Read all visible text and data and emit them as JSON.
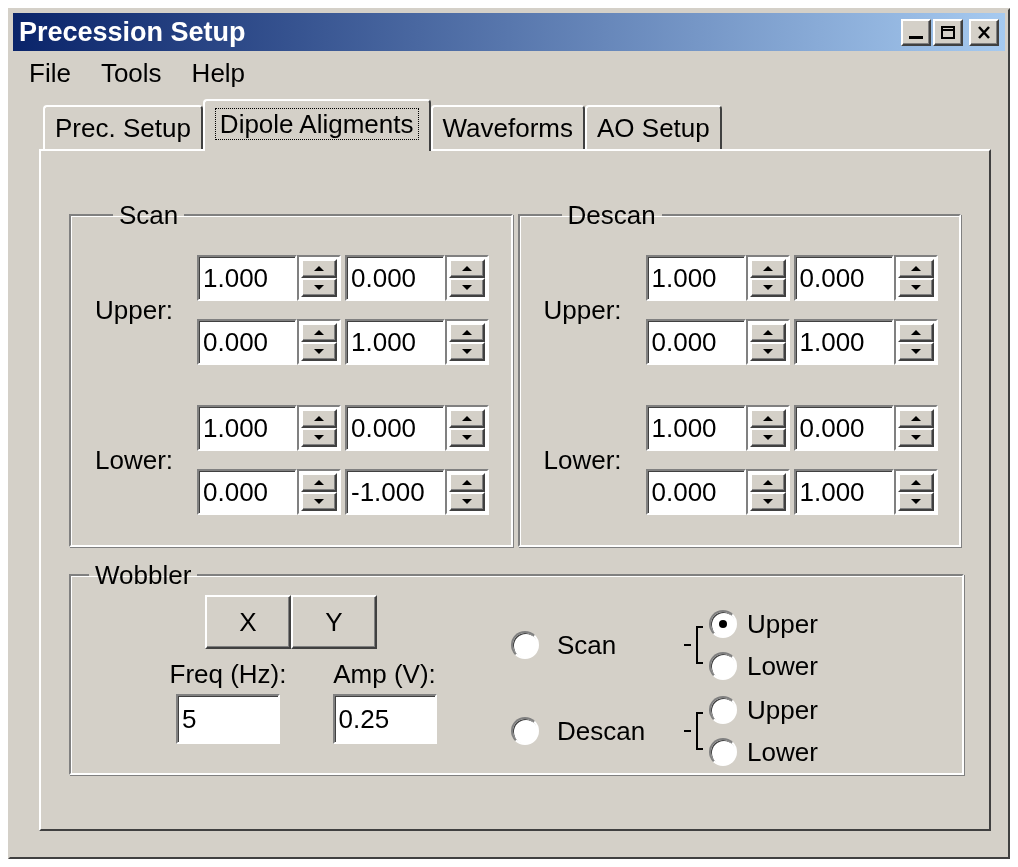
{
  "window": {
    "title": "Precession Setup"
  },
  "menu": [
    "File",
    "Tools",
    "Help"
  ],
  "tabs": [
    {
      "label": "Prec. Setup",
      "selected": false
    },
    {
      "label": "Dipole Aligments",
      "selected": true
    },
    {
      "label": "Waveforms",
      "selected": false
    },
    {
      "label": "AO Setup",
      "selected": false
    }
  ],
  "alignment_groups": [
    {
      "title": "Scan",
      "sections": [
        {
          "label": "Upper:",
          "values": [
            "1.000",
            "0.000",
            "0.000",
            "1.000"
          ]
        },
        {
          "label": "Lower:",
          "values": [
            "1.000",
            "0.000",
            "0.000",
            "-1.000"
          ]
        }
      ]
    },
    {
      "title": "Descan",
      "sections": [
        {
          "label": "Upper:",
          "values": [
            "1.000",
            "0.000",
            "0.000",
            "1.000"
          ]
        },
        {
          "label": "Lower:",
          "values": [
            "1.000",
            "0.000",
            "0.000",
            "1.000"
          ]
        }
      ]
    }
  ],
  "wobbler": {
    "title": "Wobbler",
    "buttons": [
      "X",
      "Y"
    ],
    "fields": [
      {
        "label": "Freq (Hz):",
        "value": "5"
      },
      {
        "label": "Amp (V):",
        "value": "0.25"
      }
    ],
    "sources": [
      {
        "label": "Scan",
        "selected": false,
        "options": [
          {
            "label": "Upper",
            "selected": true
          },
          {
            "label": "Lower",
            "selected": false
          }
        ]
      },
      {
        "label": "Descan",
        "selected": false,
        "options": [
          {
            "label": "Upper",
            "selected": false
          },
          {
            "label": "Lower",
            "selected": false
          }
        ]
      }
    ]
  }
}
